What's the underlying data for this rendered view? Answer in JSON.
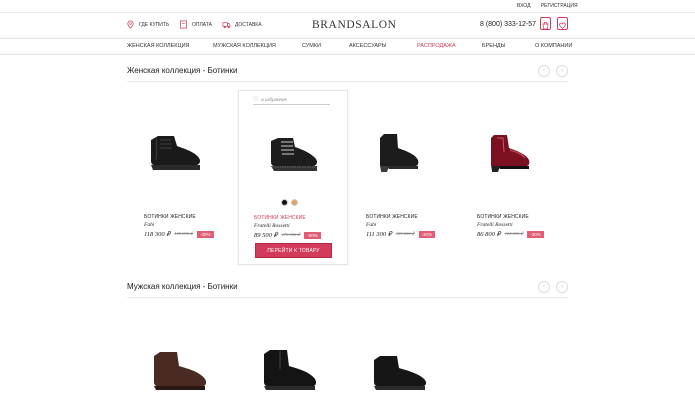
{
  "topbar": {
    "login": "ВХОД",
    "register": "РЕГИСТРАЦИЯ"
  },
  "header": {
    "where_to_buy": "ГДЕ КУПИТЬ",
    "payment": "ОПЛАТА",
    "delivery": "ДОСТАВКА",
    "logo": "BRANDSALON",
    "phone": "8 (800) 333-12-57",
    "cart_count": "0",
    "fav_count": "0"
  },
  "nav": {
    "items": [
      "ЖЕНСКАЯ КОЛЛЕКЦИЯ",
      "МУЖСКАЯ КОЛЛЕКЦИЯ",
      "СУМКИ",
      "АКСЕССУАРЫ",
      "РАСПРОДАЖА",
      "БРЕНДЫ",
      "О КОМПАНИИ"
    ]
  },
  "women": {
    "title": "Женская коллекция - Ботинки",
    "favorite_label": "в избранное",
    "button_label": "ПЕРЕЙТИ К ТОВАРУ",
    "products": [
      {
        "type": "БОТИНКИ ЖЕНСКИЕ",
        "brand": "Fabi",
        "price": "118 300 ₽",
        "old_price": "169 000 ₽",
        "discount": "-30%"
      },
      {
        "type": "БОТИНКИ ЖЕНСКИЕ",
        "brand": "Fratelli Rossetti",
        "price": "89 500 ₽",
        "old_price": "179 000 ₽",
        "discount": "-50%"
      },
      {
        "type": "БОТИНКИ ЖЕНСКИЕ",
        "brand": "Fabi",
        "price": "111 300 ₽",
        "old_price": "159 000 ₽",
        "discount": "-30%"
      },
      {
        "type": "БОТИНКИ ЖЕНСКИЕ",
        "brand": "Fratelli Rossetti",
        "price": "86 800 ₽",
        "old_price": "124 000 ₽",
        "discount": "-30%"
      }
    ],
    "colors": [
      "#111111",
      "#e8a060"
    ]
  },
  "men": {
    "title": "Мужская коллекция - Ботинки"
  },
  "colors": {
    "accent": "#d23b5b",
    "discount": "#e25c74"
  },
  "icons": [
    "location-icon",
    "payment-icon",
    "delivery-icon",
    "cart-icon",
    "favorites-icon",
    "heart-icon",
    "arrow-left-icon",
    "arrow-right-icon"
  ]
}
